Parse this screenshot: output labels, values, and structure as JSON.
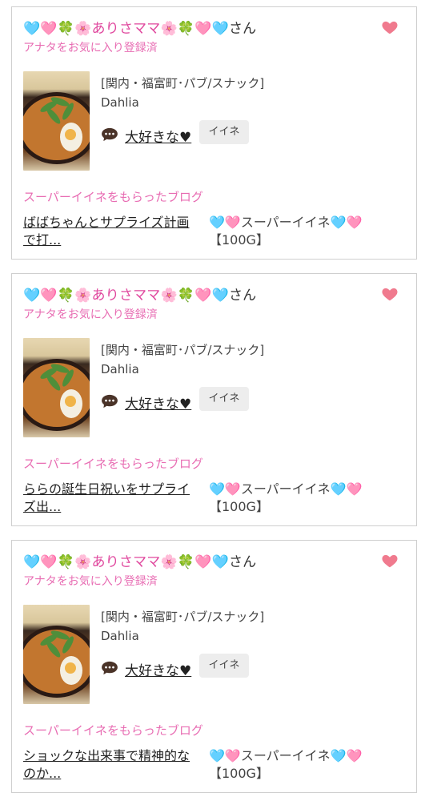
{
  "cards": [
    {
      "user_name": "🩵🩷🍀🌸ありさママ🌸🍀🩷🩵",
      "san": "さん",
      "fav_status": "アナタをお気に入り登録済",
      "shop_area": "[関内・福富町･パブ/スナック]",
      "shop_name": "Dahlia",
      "daisuki_label": "大好きな♥",
      "iine_label": "イイネ",
      "section_title": "スーパーイイネをもらったブログ",
      "blog_title": "ばばちゃんとサプライズ計画で打...",
      "badge": "🩵🩷スーパーイイネ🩵🩷【100G】"
    },
    {
      "user_name": "🩵🩷🍀🌸ありさママ🌸🍀🩷🩵",
      "san": "さん",
      "fav_status": "アナタをお気に入り登録済",
      "shop_area": "[関内・福富町･パブ/スナック]",
      "shop_name": "Dahlia",
      "daisuki_label": "大好きな♥",
      "iine_label": "イイネ",
      "section_title": "スーパーイイネをもらったブログ",
      "blog_title": "ららの誕生日祝いをサプライズ出...",
      "badge": "🩵🩷スーパーイイネ🩵🩷【100G】"
    },
    {
      "user_name": "🩵🩷🍀🌸ありさママ🌸🍀🩷🩵",
      "san": "さん",
      "fav_status": "アナタをお気に入り登録済",
      "shop_area": "[関内・福富町･パブ/スナック]",
      "shop_name": "Dahlia",
      "daisuki_label": "大好きな♥",
      "iine_label": "イイネ",
      "section_title": "スーパーイイネをもらったブログ",
      "blog_title": "ショックな出来事で精神的なのか...",
      "badge": "🩵🩷スーパーイイネ🩵🩷【100G】"
    }
  ],
  "icons": {
    "heart": "heart-icon",
    "comment": "speech-bubble-icon",
    "photo": "ramen-photo"
  },
  "colors": {
    "pink_text": "#e86db3",
    "heart": "#f07a8e",
    "border": "#cfcfcf",
    "button_bg": "#ededed"
  }
}
